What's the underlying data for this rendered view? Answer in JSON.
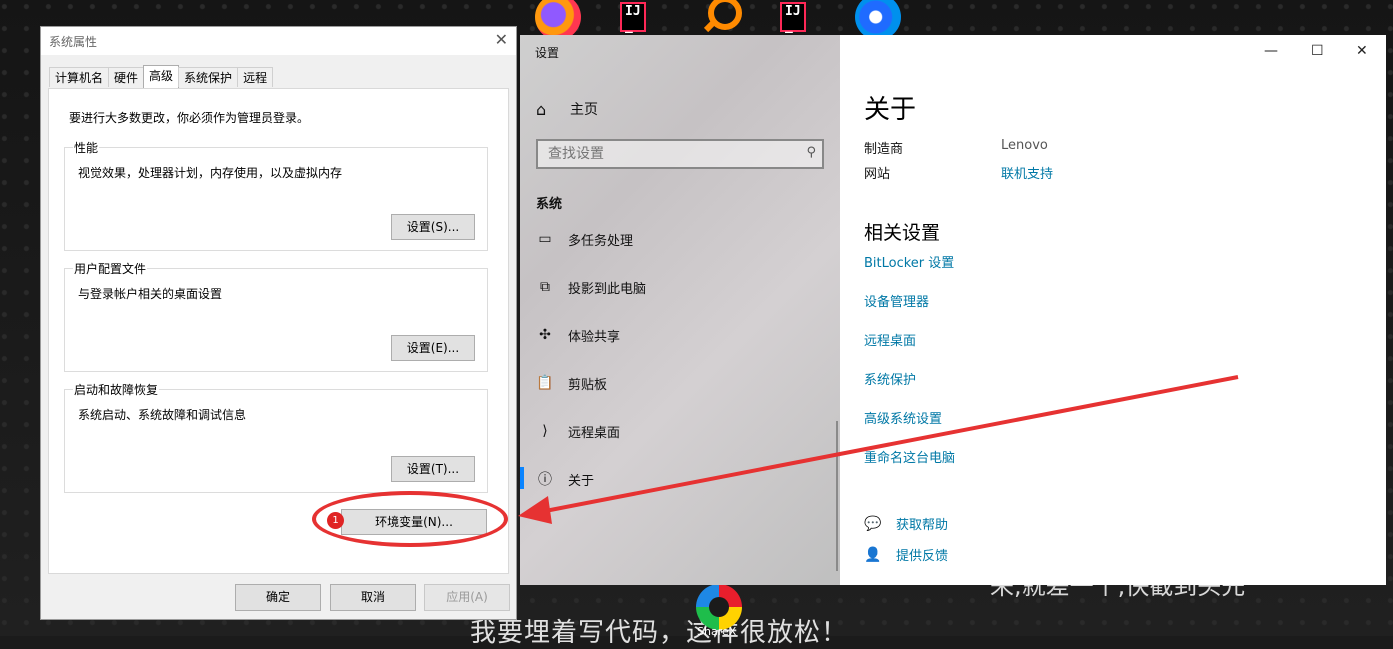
{
  "desktop": {
    "bottom_text": "我要埋着写代码，这样很放松！",
    "bottom_text2": "来,就差一个,快截到头先",
    "sharex_label": "ShareX"
  },
  "system_properties": {
    "title": "系统属性",
    "tabs": [
      {
        "label": "计算机名",
        "active": false
      },
      {
        "label": "硬件",
        "active": false
      },
      {
        "label": "高级",
        "active": true
      },
      {
        "label": "系统保护",
        "active": false
      },
      {
        "label": "远程",
        "active": false
      }
    ],
    "warning": "要进行大多数更改，你必须作为管理员登录。",
    "groups": [
      {
        "title": "性能",
        "desc": "视觉效果，处理器计划，内存使用，以及虚拟内存",
        "button": "设置(S)..."
      },
      {
        "title": "用户配置文件",
        "desc": "与登录帐户相关的桌面设置",
        "button": "设置(E)..."
      },
      {
        "title": "启动和故障恢复",
        "desc": "系统启动、系统故障和调试信息",
        "button": "设置(T)..."
      }
    ],
    "env_button": "环境变量(N)...",
    "badge": "1",
    "footer": {
      "ok": "确定",
      "cancel": "取消",
      "apply": "应用(A)"
    },
    "accent_color": "#e63232"
  },
  "settings": {
    "title": "设置",
    "home": "主页",
    "search_placeholder": "查找设置",
    "section": "系统",
    "nav_items": [
      {
        "label": "多任务处理",
        "icon": "multitask-icon"
      },
      {
        "label": "投影到此电脑",
        "icon": "project-icon"
      },
      {
        "label": "体验共享",
        "icon": "share-icon"
      },
      {
        "label": "剪贴板",
        "icon": "clipboard-icon"
      },
      {
        "label": "远程桌面",
        "icon": "remote-desktop-icon"
      },
      {
        "label": "关于",
        "icon": "info-icon",
        "selected": true
      }
    ],
    "about": {
      "title": "关于",
      "manufacturer_label": "制造商",
      "manufacturer_value": "Lenovo",
      "website_label": "网站",
      "website_value": "联机支持"
    },
    "related": {
      "title": "相关设置",
      "links": [
        "BitLocker 设置",
        "设备管理器",
        "远程桌面",
        "系统保护",
        "高级系统设置",
        "重命名这台电脑"
      ]
    },
    "help": {
      "get_help": "获取帮助",
      "feedback": "提供反馈"
    },
    "link_color": "#0078a6"
  }
}
